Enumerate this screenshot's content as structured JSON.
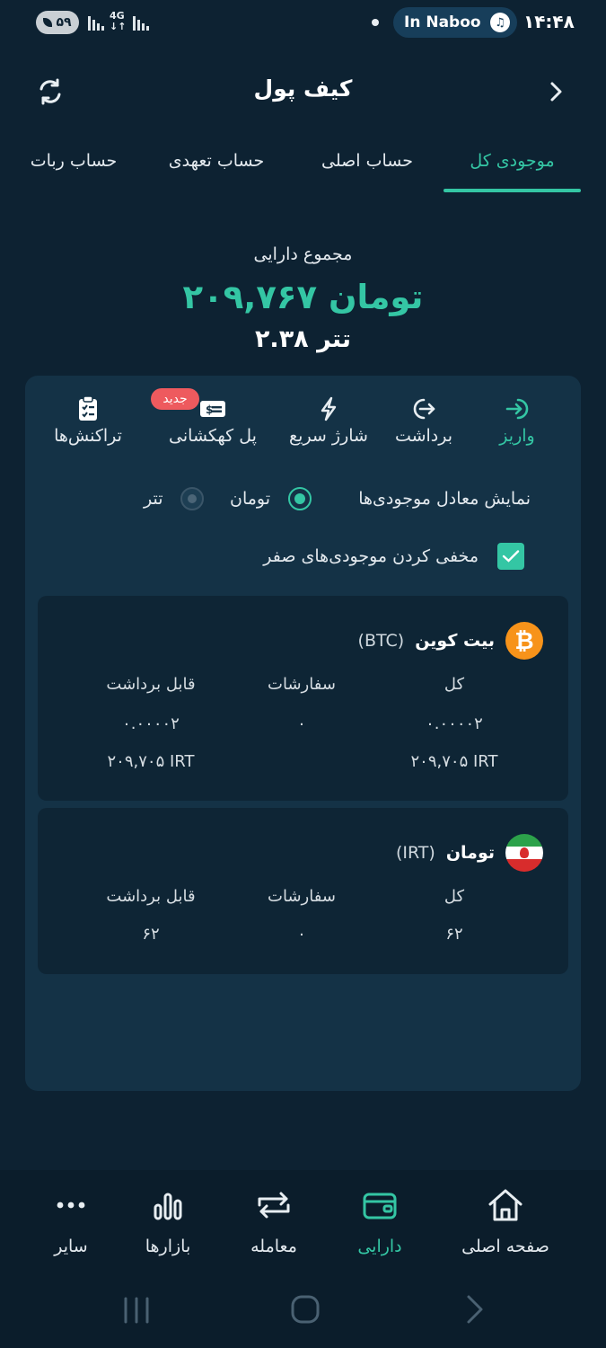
{
  "status_bar": {
    "battery": "۵۹",
    "network": "4G",
    "media_title": "In Naboo",
    "time": "۱۴:۴۸"
  },
  "header": {
    "title": "کیف پول"
  },
  "tabs": [
    {
      "label": "موجودی کل",
      "active": true
    },
    {
      "label": "حساب اصلی",
      "active": false
    },
    {
      "label": "حساب تعهدی",
      "active": false
    },
    {
      "label": "حساب ربات",
      "active": false
    }
  ],
  "summary": {
    "label": "مجموع دارایی",
    "toman_total": "۲۰۹,۷۶۷ تومان",
    "tether_total": "۲.۳۸ تتر"
  },
  "actions": [
    {
      "label": "واریز",
      "icon": "deposit-icon"
    },
    {
      "label": "برداشت",
      "icon": "withdraw-icon"
    },
    {
      "label": "شارژ سریع",
      "icon": "lightning-icon"
    },
    {
      "label": "پل کهکشانی",
      "icon": "money-card-icon",
      "badge": "جدید"
    },
    {
      "label": "تراکنش‌ها",
      "icon": "clipboard-icon"
    }
  ],
  "equivalent": {
    "label": "نمایش معادل موجودی‌ها",
    "options": [
      {
        "label": "تومان",
        "selected": true
      },
      {
        "label": "تتر",
        "selected": false
      }
    ]
  },
  "hide_zero": {
    "label": "مخفی کردن موجودی‌های صفر",
    "checked": true
  },
  "columns": {
    "total": "کل",
    "orders": "سفارشات",
    "withdrawable": "قابل برداشت"
  },
  "assets": [
    {
      "name": "بیت کوین",
      "code": "(BTC)",
      "total": "۰.۰۰۰۰۲",
      "orders": "۰",
      "withdrawable": "۰.۰۰۰۰۲",
      "total_irt": "۲۰۹,۷۰۵ IRT",
      "withdrawable_irt": "۲۰۹,۷۰۵ IRT"
    },
    {
      "name": "تومان",
      "code": "(IRT)",
      "total": "۶۲",
      "orders": "۰",
      "withdrawable": "۶۲"
    }
  ],
  "bottom_nav": [
    {
      "label": "صفحه اصلی",
      "icon": "home-icon",
      "active": false
    },
    {
      "label": "دارایی",
      "icon": "wallet-icon",
      "active": true
    },
    {
      "label": "معامله",
      "icon": "swap-icon",
      "active": false
    },
    {
      "label": "بازارها",
      "icon": "bar-chart-icon",
      "active": false
    },
    {
      "label": "سایر",
      "icon": "more-icon",
      "active": false
    }
  ],
  "colors": {
    "background": "#0d2232",
    "panel": "#143246",
    "accent": "#34c6a4",
    "badge": "#ee5a5e"
  }
}
